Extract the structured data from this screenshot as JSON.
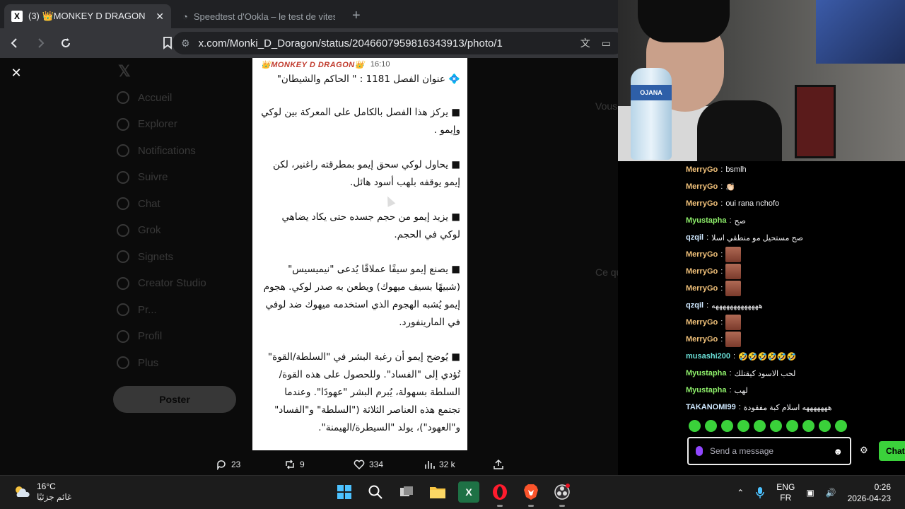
{
  "browser": {
    "tabs": [
      {
        "badge_title": "(3) 👑MONKEY D DRAGON",
        "active": true
      },
      {
        "badge_title": "Speedtest d'Ookla – le test de vitesse",
        "active": false
      }
    ],
    "url": "x.com/Monki_D_Doragon/status/2046607959816343913/photo/1"
  },
  "x_sidebar": [
    "Accueil",
    "Explorer",
    "Notifications",
    "Suivre",
    "Chat",
    "Grok",
    "Signets",
    "Creator Studio",
    "Pr...",
    "Profil",
    "Plus"
  ],
  "x_post_button": "Poster",
  "x_right": {
    "follow_title": "Vous...",
    "whats_happening": "Ce qui se passe"
  },
  "photo": {
    "channel_name": "👑MONKEY D DRAGON👑",
    "time": "16:10",
    "paragraphs": [
      "💠 عنوان الفصل 1181 : \" الحاكم والشيطان\"",
      "■ يركز هذا الفصل بالكامل على المعركة بين لوكي وإيمو .",
      "■ يحاول لوكي سحق إيمو بمطرقته راغنير، لكن إيمو يوقفه بلهب أسود هائل.",
      "■ يزيد إيمو من حجم جسده حتى يكاد يضاهي لوكي في الحجم.",
      "■ يصنع إيمو سيفًا عملاقًا يُدعى \"نيميسيس\" (شبيهًا بسيف ميهوك) ويطعن به صدر لوكي. هجوم إيمو يُشبه الهجوم الذي استخدمه ميهوك ضد لوفي في المارينفورد.",
      "■ يُوضح إيمو أن رغبة البشر في \"السلطة/القوة\" تُؤدي إلى \"الفساد\". وللحصول على هذه القوة/السلطة بسهولة، يُبرم البشر \"عهودًا\". وعندما تجتمع هذه العناصر الثلاثة (\"السلطة\" و\"الفساد\" و\"العهود\")، يولد \"السيطرة/الهيمنة\"."
    ]
  },
  "actions": {
    "replies": "23",
    "reposts": "9",
    "likes": "334",
    "views": "32 k"
  },
  "webcam": {
    "bottle_brand": "OJANA"
  },
  "chat": {
    "messages": [
      {
        "user": "MerryGo",
        "color": "#f2c27a",
        "text": "bsmlh"
      },
      {
        "user": "MerryGo",
        "color": "#f2c27a",
        "text": "👏🏻"
      },
      {
        "user": "MerryGo",
        "color": "#f2c27a",
        "text": "oui rana nchofo"
      },
      {
        "user": "Myustapha",
        "color": "#8ff06b",
        "text": "صح"
      },
      {
        "user": "qzqil",
        "color": "#cfe8ff",
        "text": "صح مستحيل مو منطقي اسلا"
      },
      {
        "user": "MerryGo",
        "color": "#f2c27a",
        "text": "",
        "emote": true
      },
      {
        "user": "MerryGo",
        "color": "#f2c27a",
        "text": "",
        "emote": true
      },
      {
        "user": "MerryGo",
        "color": "#f2c27a",
        "text": "",
        "emote": true
      },
      {
        "user": "qzqil",
        "color": "#cfe8ff",
        "text": "هههههههههههههه"
      },
      {
        "user": "MerryGo",
        "color": "#f2c27a",
        "text": "",
        "emote": true
      },
      {
        "user": "MerryGo",
        "color": "#f2c27a",
        "text": "",
        "emote": true
      },
      {
        "user": "musashi200",
        "color": "#6be0d8",
        "text": "🤣🤣🤣🤣🤣🤣"
      },
      {
        "user": "Myustapha",
        "color": "#8ff06b",
        "text": "لحب الاسود كيقتلك"
      },
      {
        "user": "Myustapha",
        "color": "#8ff06b",
        "text": "لهب"
      },
      {
        "user": "TAKANOMI99",
        "color": "#cfe8ff",
        "text": "هههههههه اسلام كبة مفقودة"
      }
    ],
    "input_placeholder": "Send a message",
    "chat_button": "Chat"
  },
  "taskbar": {
    "temperature": "16°C",
    "weather_condition": "غائم جزئيًا",
    "lang_top": "ENG",
    "lang_bottom": "FR",
    "time": "0:26",
    "date": "2026-04-23"
  }
}
